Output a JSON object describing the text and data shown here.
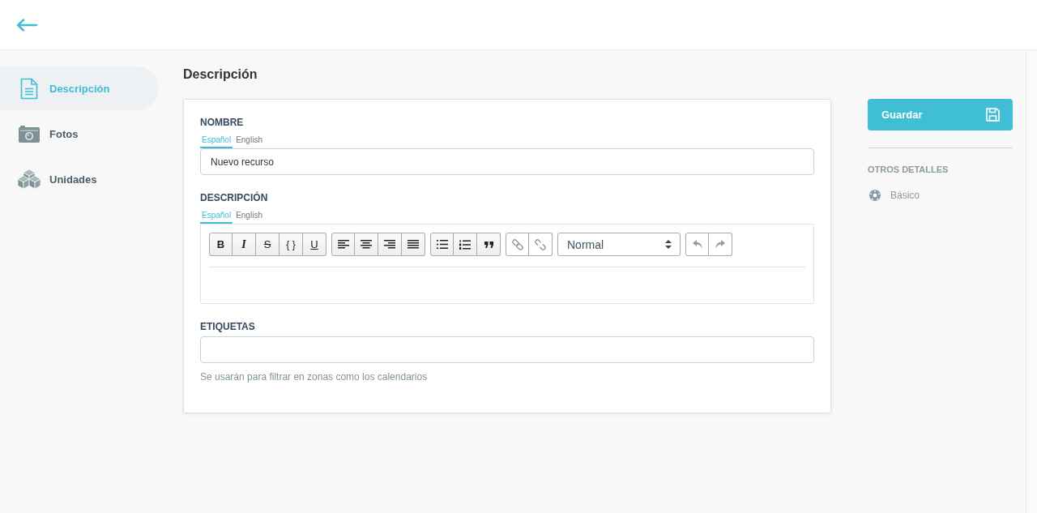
{
  "sidebar": {
    "items": [
      {
        "label": "Descripción",
        "kind": "document",
        "selected": true
      },
      {
        "label": "Fotos",
        "kind": "camera",
        "selected": false
      },
      {
        "label": "Unidades",
        "kind": "cubes",
        "selected": false
      }
    ]
  },
  "page_title": "Descripción",
  "form": {
    "fields": [
      {
        "kind": "text",
        "label": "NOMBRE",
        "languages": [
          {
            "label": "Español",
            "selected": true
          },
          {
            "label": "English",
            "selected": false
          }
        ],
        "value": "Nuevo recurso"
      },
      {
        "kind": "rich_text",
        "label": "DESCRIPCIÓN",
        "languages": [
          {
            "label": "Español",
            "selected": true
          },
          {
            "label": "English",
            "selected": false
          }
        ],
        "toolbar": [
          {
            "kind": "group",
            "buttons": [
              {
                "kind": "bold",
                "label": "B",
                "disabled": false
              },
              {
                "kind": "italic",
                "label": "I",
                "disabled": false
              },
              {
                "kind": "strikethrough",
                "label": "S",
                "disabled": false
              },
              {
                "kind": "code",
                "label": "{ }",
                "disabled": false
              },
              {
                "kind": "underline",
                "label": "U",
                "disabled": false
              }
            ]
          },
          {
            "kind": "group",
            "buttons": [
              {
                "kind": "align-left",
                "disabled": false
              },
              {
                "kind": "align-center",
                "disabled": false
              },
              {
                "kind": "align-right",
                "disabled": false
              },
              {
                "kind": "justify",
                "disabled": false
              }
            ]
          },
          {
            "kind": "group",
            "buttons": [
              {
                "kind": "bullet-list",
                "disabled": false
              },
              {
                "kind": "numbered-list",
                "disabled": false
              },
              {
                "kind": "quote",
                "disabled": false
              }
            ]
          },
          {
            "kind": "group",
            "buttons": [
              {
                "kind": "link",
                "disabled": true
              },
              {
                "kind": "unlink",
                "disabled": true
              }
            ]
          },
          {
            "kind": "select",
            "value": "Normal"
          },
          {
            "kind": "group",
            "buttons": [
              {
                "kind": "undo",
                "disabled": true
              },
              {
                "kind": "redo",
                "disabled": true
              }
            ]
          }
        ]
      },
      {
        "kind": "tags",
        "label": "ETIQUETAS",
        "hint": "Se usarán para filtrar en zonas como los calendarios"
      }
    ]
  },
  "save_button": {
    "label": "Guardar"
  },
  "other_details": {
    "title": "OTROS DETALLES",
    "items": [
      {
        "label": "Básico"
      }
    ]
  }
}
